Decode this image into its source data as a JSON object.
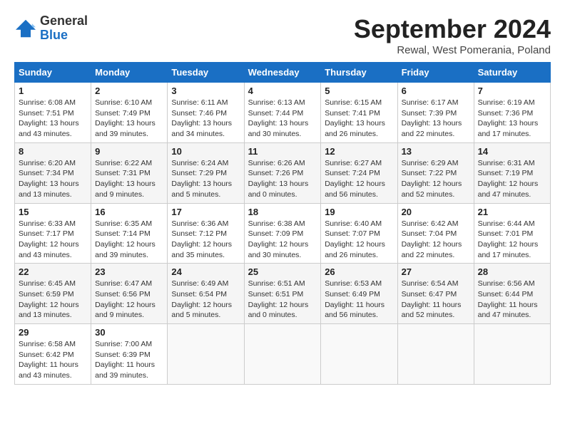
{
  "header": {
    "logo": {
      "line1": "General",
      "line2": "Blue"
    },
    "title": "September 2024",
    "subtitle": "Rewal, West Pomerania, Poland"
  },
  "weekdays": [
    "Sunday",
    "Monday",
    "Tuesday",
    "Wednesday",
    "Thursday",
    "Friday",
    "Saturday"
  ],
  "weeks": [
    [
      {
        "day": "1",
        "info": "Sunrise: 6:08 AM\nSunset: 7:51 PM\nDaylight: 13 hours\nand 43 minutes."
      },
      {
        "day": "2",
        "info": "Sunrise: 6:10 AM\nSunset: 7:49 PM\nDaylight: 13 hours\nand 39 minutes."
      },
      {
        "day": "3",
        "info": "Sunrise: 6:11 AM\nSunset: 7:46 PM\nDaylight: 13 hours\nand 34 minutes."
      },
      {
        "day": "4",
        "info": "Sunrise: 6:13 AM\nSunset: 7:44 PM\nDaylight: 13 hours\nand 30 minutes."
      },
      {
        "day": "5",
        "info": "Sunrise: 6:15 AM\nSunset: 7:41 PM\nDaylight: 13 hours\nand 26 minutes."
      },
      {
        "day": "6",
        "info": "Sunrise: 6:17 AM\nSunset: 7:39 PM\nDaylight: 13 hours\nand 22 minutes."
      },
      {
        "day": "7",
        "info": "Sunrise: 6:19 AM\nSunset: 7:36 PM\nDaylight: 13 hours\nand 17 minutes."
      }
    ],
    [
      {
        "day": "8",
        "info": "Sunrise: 6:20 AM\nSunset: 7:34 PM\nDaylight: 13 hours\nand 13 minutes."
      },
      {
        "day": "9",
        "info": "Sunrise: 6:22 AM\nSunset: 7:31 PM\nDaylight: 13 hours\nand 9 minutes."
      },
      {
        "day": "10",
        "info": "Sunrise: 6:24 AM\nSunset: 7:29 PM\nDaylight: 13 hours\nand 5 minutes."
      },
      {
        "day": "11",
        "info": "Sunrise: 6:26 AM\nSunset: 7:26 PM\nDaylight: 13 hours\nand 0 minutes."
      },
      {
        "day": "12",
        "info": "Sunrise: 6:27 AM\nSunset: 7:24 PM\nDaylight: 12 hours\nand 56 minutes."
      },
      {
        "day": "13",
        "info": "Sunrise: 6:29 AM\nSunset: 7:22 PM\nDaylight: 12 hours\nand 52 minutes."
      },
      {
        "day": "14",
        "info": "Sunrise: 6:31 AM\nSunset: 7:19 PM\nDaylight: 12 hours\nand 47 minutes."
      }
    ],
    [
      {
        "day": "15",
        "info": "Sunrise: 6:33 AM\nSunset: 7:17 PM\nDaylight: 12 hours\nand 43 minutes."
      },
      {
        "day": "16",
        "info": "Sunrise: 6:35 AM\nSunset: 7:14 PM\nDaylight: 12 hours\nand 39 minutes."
      },
      {
        "day": "17",
        "info": "Sunrise: 6:36 AM\nSunset: 7:12 PM\nDaylight: 12 hours\nand 35 minutes."
      },
      {
        "day": "18",
        "info": "Sunrise: 6:38 AM\nSunset: 7:09 PM\nDaylight: 12 hours\nand 30 minutes."
      },
      {
        "day": "19",
        "info": "Sunrise: 6:40 AM\nSunset: 7:07 PM\nDaylight: 12 hours\nand 26 minutes."
      },
      {
        "day": "20",
        "info": "Sunrise: 6:42 AM\nSunset: 7:04 PM\nDaylight: 12 hours\nand 22 minutes."
      },
      {
        "day": "21",
        "info": "Sunrise: 6:44 AM\nSunset: 7:01 PM\nDaylight: 12 hours\nand 17 minutes."
      }
    ],
    [
      {
        "day": "22",
        "info": "Sunrise: 6:45 AM\nSunset: 6:59 PM\nDaylight: 12 hours\nand 13 minutes."
      },
      {
        "day": "23",
        "info": "Sunrise: 6:47 AM\nSunset: 6:56 PM\nDaylight: 12 hours\nand 9 minutes."
      },
      {
        "day": "24",
        "info": "Sunrise: 6:49 AM\nSunset: 6:54 PM\nDaylight: 12 hours\nand 5 minutes."
      },
      {
        "day": "25",
        "info": "Sunrise: 6:51 AM\nSunset: 6:51 PM\nDaylight: 12 hours\nand 0 minutes."
      },
      {
        "day": "26",
        "info": "Sunrise: 6:53 AM\nSunset: 6:49 PM\nDaylight: 11 hours\nand 56 minutes."
      },
      {
        "day": "27",
        "info": "Sunrise: 6:54 AM\nSunset: 6:47 PM\nDaylight: 11 hours\nand 52 minutes."
      },
      {
        "day": "28",
        "info": "Sunrise: 6:56 AM\nSunset: 6:44 PM\nDaylight: 11 hours\nand 47 minutes."
      }
    ],
    [
      {
        "day": "29",
        "info": "Sunrise: 6:58 AM\nSunset: 6:42 PM\nDaylight: 11 hours\nand 43 minutes."
      },
      {
        "day": "30",
        "info": "Sunrise: 7:00 AM\nSunset: 6:39 PM\nDaylight: 11 hours\nand 39 minutes."
      },
      null,
      null,
      null,
      null,
      null
    ]
  ]
}
